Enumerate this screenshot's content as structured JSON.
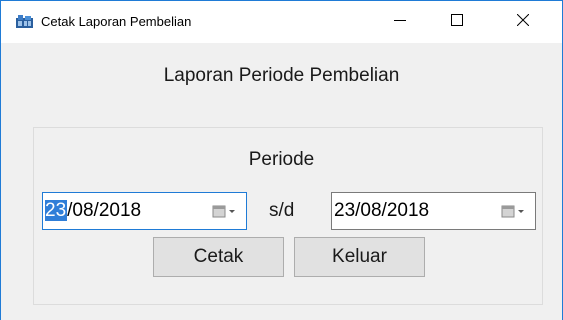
{
  "window": {
    "title": "Cetak Laporan Pembelian",
    "icon": "app-window-icon",
    "controls": [
      "minimize-icon",
      "maximize-icon",
      "close-icon"
    ]
  },
  "header": {
    "title": "Laporan Periode Pembelian"
  },
  "form": {
    "periode_label": "Periode",
    "date_from": {
      "day": "23",
      "rest": "/08/2018",
      "icon": "calendar-dropdown-icon"
    },
    "separator": "s/d",
    "date_to": {
      "value": "23/08/2018",
      "icon": "calendar-dropdown-icon"
    }
  },
  "buttons": {
    "print": "Cetak",
    "exit": "Keluar"
  },
  "colors": {
    "accent": "#1f7bd6",
    "selection": "#2f7ed8",
    "window_bg": "#f0f0f0",
    "button_bg": "#e1e1e1"
  }
}
